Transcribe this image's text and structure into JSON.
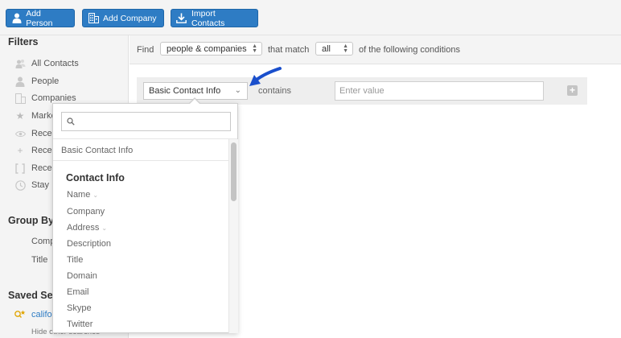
{
  "toolbar": {
    "add_person": "Add Person",
    "add_company": "Add Company",
    "import_contacts": "Import Contacts",
    "person_icon": "person-icon",
    "company_icon": "building-icon",
    "import_icon": "download-icon"
  },
  "sidebar": {
    "filters_heading": "Filters",
    "filters": [
      {
        "label": "All Contacts",
        "icon": "contacts-icon"
      },
      {
        "label": "People",
        "icon": "person-icon"
      },
      {
        "label": "Companies",
        "icon": "building-icon"
      },
      {
        "label": "Marke",
        "icon": "star-icon"
      },
      {
        "label": "Recen",
        "icon": "eye-icon"
      },
      {
        "label": "Recen",
        "icon": "plus-icon"
      },
      {
        "label": "Recen",
        "icon": "bracket-icon"
      },
      {
        "label": "Stay I",
        "icon": "clock-icon"
      }
    ],
    "group_by_heading": "Group By",
    "group_by": [
      "Comp",
      "Title"
    ],
    "saved_heading": "Saved Se",
    "saved_item": "califo",
    "hide_link": "Hide other searches"
  },
  "find": {
    "find_label": "Find",
    "scope_value": "people & companies",
    "match_label": "that match",
    "match_value": "all",
    "tail_label": "of the following conditions"
  },
  "condition": {
    "field_value": "Basic Contact Info",
    "operator": "contains",
    "value_placeholder": "Enter value",
    "add_label": "+"
  },
  "dropdown": {
    "search_placeholder": "",
    "first_option": "Basic Contact Info",
    "group_heading": "Contact Info",
    "items": [
      {
        "label": "Name",
        "expandable": true
      },
      {
        "label": "Company",
        "expandable": false
      },
      {
        "label": "Address",
        "expandable": true
      },
      {
        "label": "Description",
        "expandable": false
      },
      {
        "label": "Title",
        "expandable": false
      },
      {
        "label": "Domain",
        "expandable": false
      },
      {
        "label": "Email",
        "expandable": false
      },
      {
        "label": "Skype",
        "expandable": false
      },
      {
        "label": "Twitter",
        "expandable": false
      }
    ]
  },
  "colors": {
    "accent": "#2e7cc4",
    "annotation_arrow": "#1a4fcc"
  }
}
